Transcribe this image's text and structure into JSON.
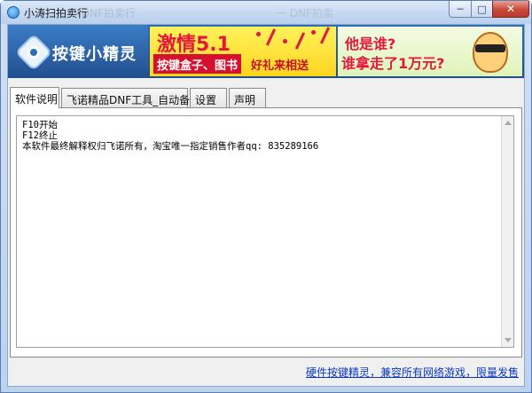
{
  "window": {
    "title": "小涛扫拍卖行",
    "ghost_title": "一 DNF拍卖行",
    "ghost_title2": "一 DNF拍卖",
    "controls": {
      "minimize": "─",
      "maximize": "□",
      "close": "✕"
    }
  },
  "banner": {
    "logo_text": "按键小精灵",
    "promo_left": {
      "headline": "激情5.1",
      "sub": "按键盒子、图书",
      "sub2": "好礼来相送"
    },
    "promo_right": {
      "line1": "他是谁?",
      "line2": "谁拿走了1万元?"
    }
  },
  "tabs": [
    {
      "label": "软件说明",
      "active": true
    },
    {
      "label": "飞诺精品DNF工具_自动备份",
      "active": false
    },
    {
      "label": "设置",
      "active": false
    },
    {
      "label": "声明",
      "active": false
    }
  ],
  "content": {
    "lines": [
      "F10开始",
      "F12终止",
      "本软件最终解释权归飞诺所有，淘宝唯一指定销售作者qq: 835289166"
    ]
  },
  "footer": {
    "link_text": "硬件按键精灵，兼容所有网络游戏，限量发售"
  },
  "colors": {
    "accent_blue": "#2f6db3",
    "promo_red": "#e5173d",
    "link": "#0b39c4"
  },
  "icons": {
    "app": "app-logo-icon",
    "minimize": "minimize-icon",
    "maximize": "maximize-icon",
    "close": "close-icon"
  }
}
